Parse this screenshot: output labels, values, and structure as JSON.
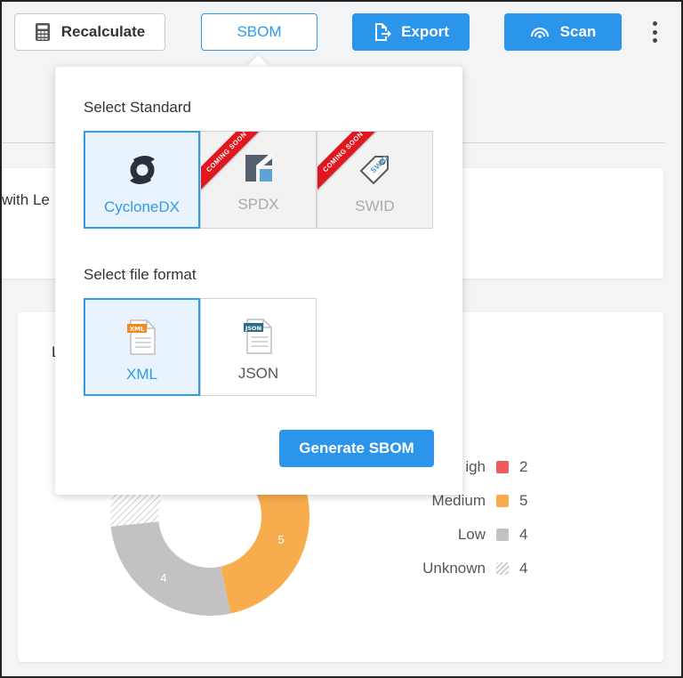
{
  "toolbar": {
    "recalculate_label": "Recalculate",
    "sbom_label": "SBOM",
    "export_label": "Export",
    "scan_label": "Scan"
  },
  "background": {
    "card1_title_fragment": "with Le",
    "card2_title_fragment": "L"
  },
  "sbom_popover": {
    "standard_label": "Select Standard",
    "standards": [
      {
        "name": "CycloneDX",
        "selected": true,
        "badge": ""
      },
      {
        "name": "SPDX",
        "selected": false,
        "badge": "COMING SOON"
      },
      {
        "name": "SWID",
        "selected": false,
        "badge": "COMING SOON"
      }
    ],
    "format_label": "Select file format",
    "formats": [
      {
        "name": "XML",
        "selected": true,
        "icon_tag": "XML"
      },
      {
        "name": "JSON",
        "selected": false,
        "icon_tag": "JSON"
      }
    ],
    "generate_label": "Generate SBOM"
  },
  "severity_chart": {
    "type": "donut",
    "segments": [
      {
        "label": "High",
        "visible_label": "igh",
        "count": 2,
        "color": "#ef5a5a"
      },
      {
        "label": "Medium",
        "visible_label": "Medium",
        "count": 5,
        "color": "#f7ad4d"
      },
      {
        "label": "Low",
        "visible_label": "Low",
        "count": 4,
        "color": "#c2c2c2"
      },
      {
        "label": "Unknown",
        "visible_label": "Unknown",
        "count": 4,
        "color": "hatched"
      }
    ],
    "slice_labels": {
      "medium": "5",
      "low": "4"
    }
  },
  "colors": {
    "accent": "#2b95ec",
    "selected_bg": "#e8f3fd",
    "ribbon": "#e0171e"
  }
}
